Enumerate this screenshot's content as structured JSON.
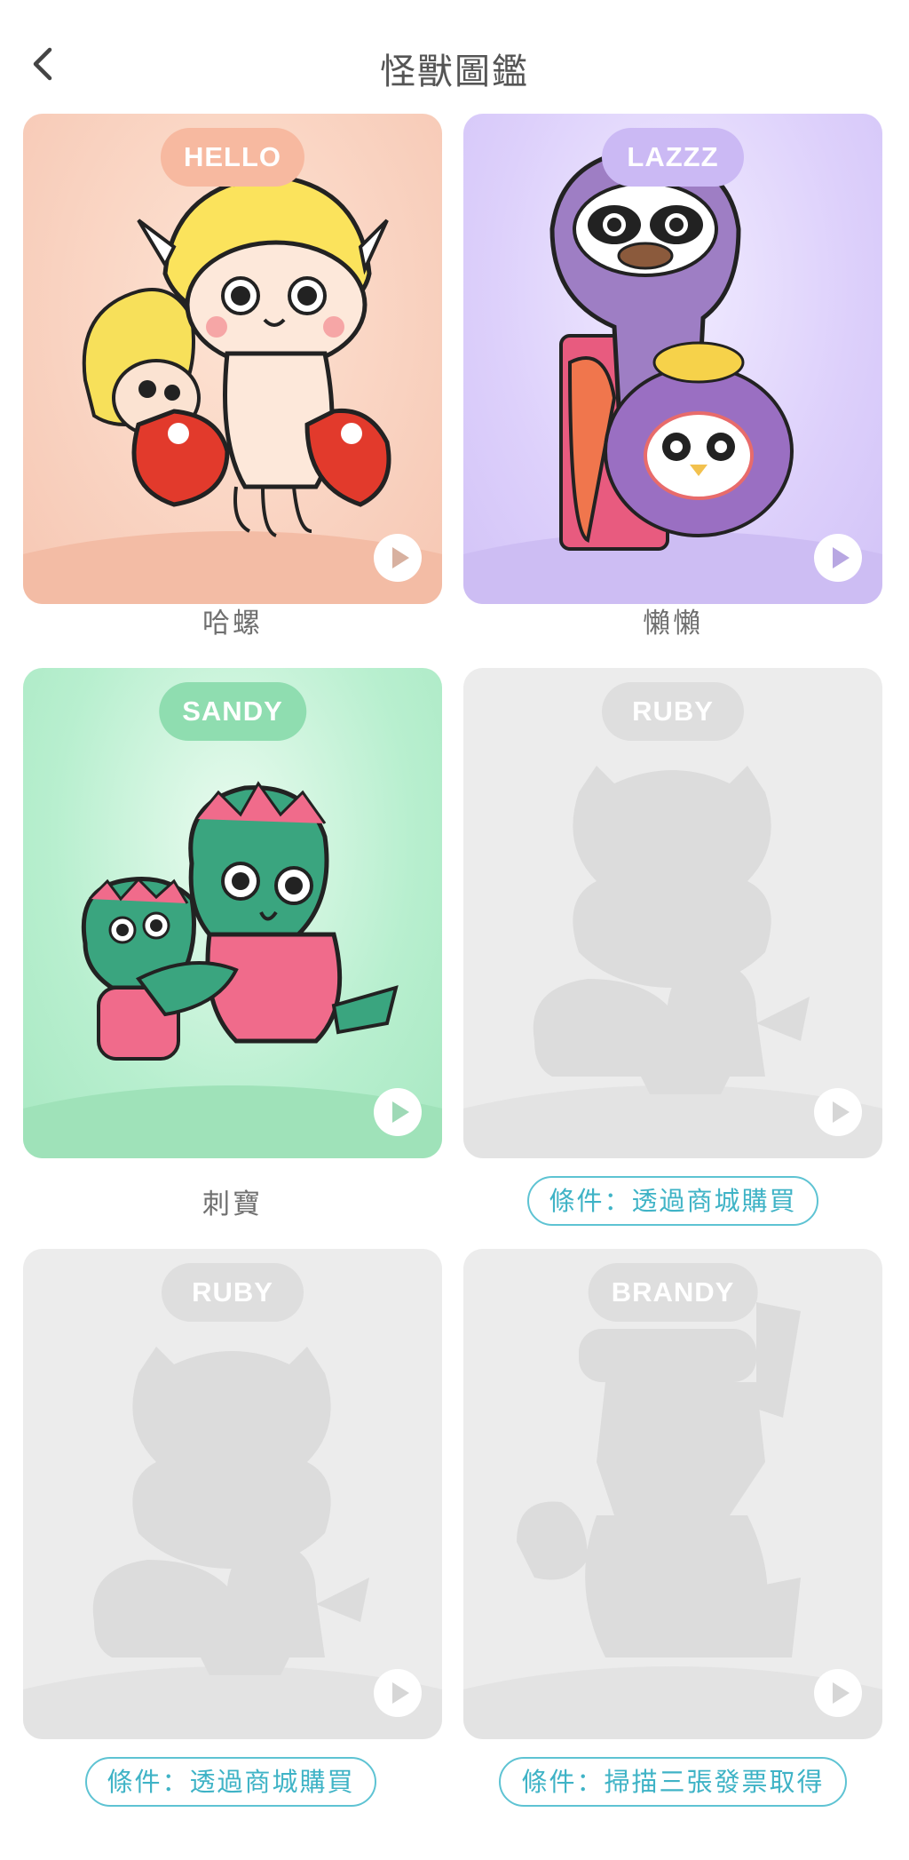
{
  "header": {
    "title": "怪獸圖鑑",
    "back_icon": "chevron-left-icon"
  },
  "cards": [
    {
      "badge": "HELLO",
      "name": "哈螺",
      "unlocked": true,
      "bg": "#f9d2c0",
      "badge_color": "#f7b9a0"
    },
    {
      "badge": "LAZZZ",
      "name": "懶懶",
      "unlocked": true,
      "bg": "#ddd0fb",
      "badge_color": "#cbb9f4"
    },
    {
      "badge": "SANDY",
      "name": "刺寶",
      "unlocked": true,
      "bg": "#b8efcf",
      "badge_color": "#8fddb0"
    },
    {
      "badge": "RUBY",
      "condition": "條件：透過商城購買",
      "unlocked": false,
      "bg": "#ececec",
      "badge_color": "#dedede"
    },
    {
      "badge": "RUBY",
      "condition": "條件：透過商城購買",
      "unlocked": false,
      "bg": "#ececec",
      "badge_color": "#dedede"
    },
    {
      "badge": "BRANDY",
      "condition": "條件：掃描三張發票取得",
      "unlocked": false,
      "bg": "#ececec",
      "badge_color": "#dedede"
    }
  ],
  "icons": {
    "play": "play-icon"
  },
  "colors": {
    "condition_accent": "#3fb3c6",
    "title": "#555555"
  }
}
